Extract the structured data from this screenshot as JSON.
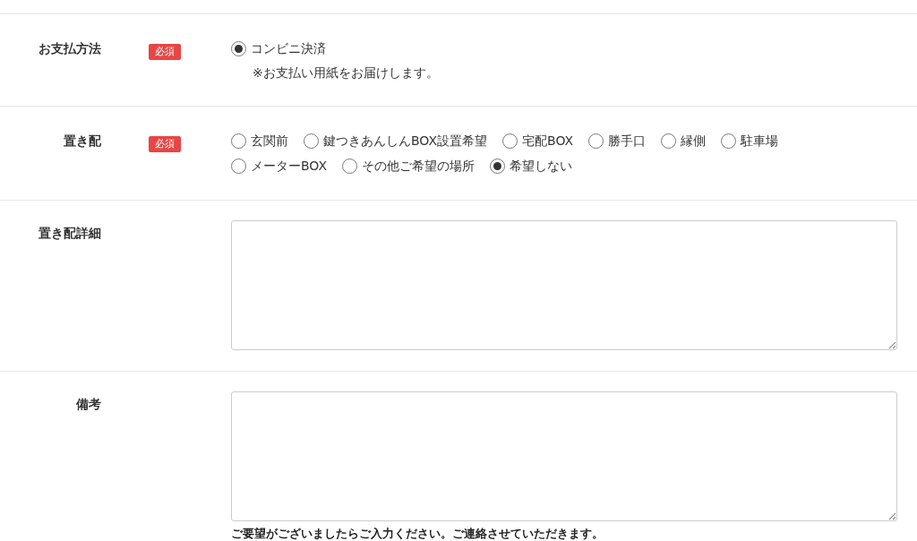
{
  "rows": [
    {
      "kind": "radio",
      "label": "お支払方法",
      "required_badge": "必須",
      "options": [
        {
          "label": "コンビニ決済",
          "selected": true
        }
      ],
      "note": "※お支払い用紙をお届けします。"
    },
    {
      "kind": "radio",
      "label": "置き配",
      "required_badge": "必須",
      "options": [
        {
          "label": "玄関前",
          "selected": false
        },
        {
          "label": "鍵つきあんしんBOX設置希望",
          "selected": false
        },
        {
          "label": "宅配BOX",
          "selected": false
        },
        {
          "label": "勝手口",
          "selected": false
        },
        {
          "label": "縁側",
          "selected": false
        },
        {
          "label": "駐車場",
          "selected": false
        },
        {
          "label": "メーターBOX",
          "selected": false
        },
        {
          "label": "その他ご希望の場所",
          "selected": false
        },
        {
          "label": "希望しない",
          "selected": true
        }
      ]
    },
    {
      "kind": "textarea",
      "label": "置き配詳細"
    },
    {
      "kind": "textarea",
      "label": "備考",
      "help": "ご要望がございましたらご入力ください。ご連絡させていただきます。"
    }
  ]
}
